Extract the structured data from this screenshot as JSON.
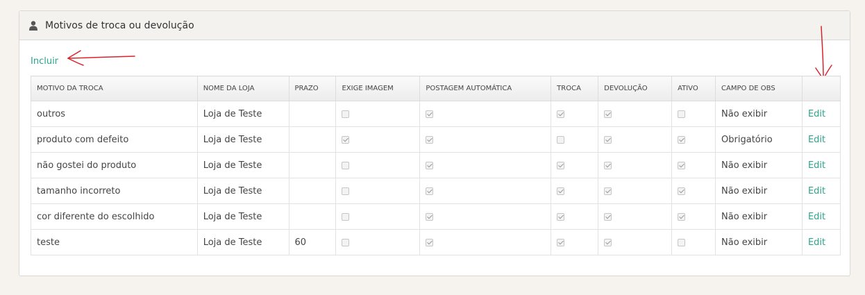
{
  "panel": {
    "title": "Motivos de troca ou devolução",
    "include_label": "Incluir"
  },
  "colors": {
    "accent": "#2aa58a",
    "annotation": "#d9232a"
  },
  "table": {
    "headers": [
      "MOTIVO DA TROCA",
      "NOME DA LOJA",
      "PRAZO",
      "EXIGE IMAGEM",
      "POSTAGEM AUTOMÁTICA",
      "TROCA",
      "DEVOLUÇÃO",
      "ATIVO",
      "CAMPO DE OBS",
      ""
    ],
    "rows": [
      {
        "motivo": "outros",
        "loja": "Loja de Teste",
        "prazo": "",
        "exige_imagem": false,
        "postagem": true,
        "troca": true,
        "devolucao": true,
        "ativo": false,
        "obs": "Não exibir",
        "action": "Edit"
      },
      {
        "motivo": "produto com defeito",
        "loja": "Loja de Teste",
        "prazo": "",
        "exige_imagem": true,
        "postagem": true,
        "troca": false,
        "devolucao": true,
        "ativo": true,
        "obs": "Obrigatório",
        "action": "Edit"
      },
      {
        "motivo": "não gostei do produto",
        "loja": "Loja de Teste",
        "prazo": "",
        "exige_imagem": false,
        "postagem": true,
        "troca": true,
        "devolucao": true,
        "ativo": true,
        "obs": "Não exibir",
        "action": "Edit"
      },
      {
        "motivo": "tamanho incorreto",
        "loja": "Loja de Teste",
        "prazo": "",
        "exige_imagem": false,
        "postagem": true,
        "troca": true,
        "devolucao": true,
        "ativo": true,
        "obs": "Não exibir",
        "action": "Edit"
      },
      {
        "motivo": "cor diferente do escolhido",
        "loja": "Loja de Teste",
        "prazo": "",
        "exige_imagem": false,
        "postagem": true,
        "troca": true,
        "devolucao": true,
        "ativo": true,
        "obs": "Não exibir",
        "action": "Edit"
      },
      {
        "motivo": "teste",
        "loja": "Loja de Teste",
        "prazo": "60",
        "exige_imagem": false,
        "postagem": true,
        "troca": true,
        "devolucao": true,
        "ativo": false,
        "obs": "Não exibir",
        "action": "Edit"
      }
    ]
  }
}
